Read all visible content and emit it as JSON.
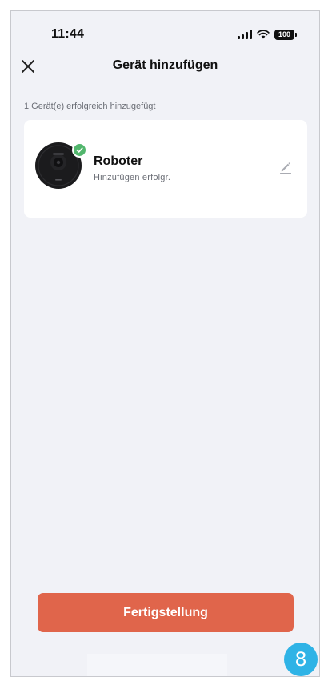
{
  "status_bar": {
    "time": "11:44",
    "battery": "100",
    "icons": [
      "cellular-signal-icon",
      "wifi-icon",
      "battery-icon"
    ]
  },
  "header": {
    "close_icon": "close-icon",
    "title": "Gerät hinzufügen"
  },
  "summary": {
    "text": "1 Gerät(e) erfolgreich hinzugefügt"
  },
  "device": {
    "name": "Roboter",
    "status": "Hinzufügen erfolgr.",
    "image": "robot-vacuum-icon",
    "badge_icon": "checkmark-icon",
    "edit_icon": "pencil-icon"
  },
  "footer": {
    "button_label": "Fertigstellung"
  },
  "overlay_badge": {
    "label": "8"
  },
  "colors": {
    "background": "#f1f2f7",
    "card": "#ffffff",
    "primary": "#e0654b",
    "success": "#52b66d",
    "badge": "#2fb3e6",
    "text": "#111111",
    "muted": "#6b6e76"
  }
}
